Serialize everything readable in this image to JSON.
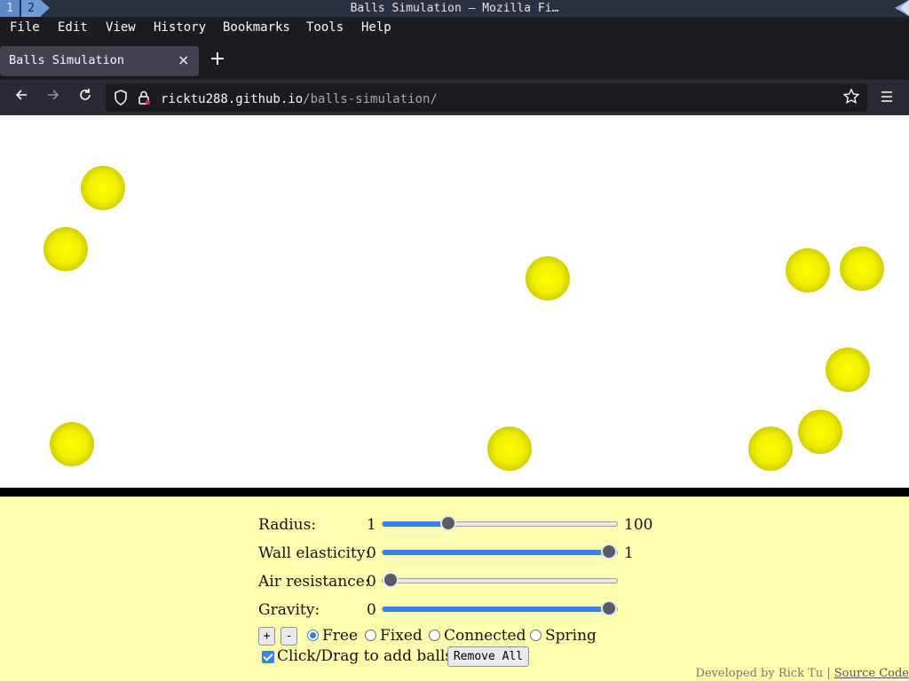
{
  "wm": {
    "workspaces": [
      "1",
      "2"
    ],
    "title": "Balls Simulation — Mozilla Fi…"
  },
  "menu": [
    "File",
    "Edit",
    "View",
    "History",
    "Bookmarks",
    "Tools",
    "Help"
  ],
  "tab": {
    "title": "Balls Simulation",
    "close": "×",
    "new_tab": "+"
  },
  "nav": {
    "url_host": "ricktu288.github.io",
    "url_path": "/balls-simulation/"
  },
  "balls_count": 11,
  "controls": {
    "radius": {
      "label": "Radius:",
      "min": "1",
      "max": "100",
      "value": 27
    },
    "elasticity": {
      "label": "Wall elasticity:",
      "min": "0",
      "max": "1",
      "value": 1.0
    },
    "air": {
      "label": "Air resistance:",
      "min": "0",
      "value": 0
    },
    "gravity": {
      "label": "Gravity:",
      "min": "0",
      "value": 1.0
    },
    "add_label": "+",
    "remove_label": "-",
    "modes": [
      "Free",
      "Fixed",
      "Connected",
      "Spring"
    ],
    "selected_mode": "Free",
    "click_drag_label": "Click/Drag to add balls",
    "click_drag_checked": true,
    "remove_all_label": "Remove All"
  },
  "footer": {
    "text": "Developed by Rick Tu |",
    "link": "Source Code"
  },
  "colors": {
    "ball": "#ffff00",
    "panel": "#ffffad",
    "accent": "#3584e4"
  }
}
